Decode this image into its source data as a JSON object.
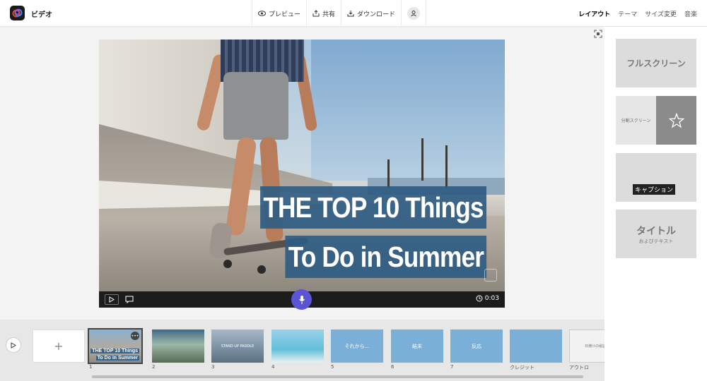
{
  "app": {
    "title": "ビデオ",
    "logo_icon": "adobe-express-logo"
  },
  "toolbar": {
    "preview_label": "プレビュー",
    "share_label": "共有",
    "download_label": "ダウンロード"
  },
  "tabs": {
    "layout": "レイアウト",
    "theme": "テーマ",
    "resize": "サイズ変更",
    "music": "音楽"
  },
  "video": {
    "caption_line1": "THE TOP 10 Things",
    "caption_line2": "To Do in Summer",
    "time": "0:03",
    "caption_color": "#2f5c82",
    "mic_color": "#5b55d6"
  },
  "layouts": {
    "fullscreen": "フルスクリーン",
    "split": "分割スクリーン",
    "caption": "キャプション",
    "title_main": "タイトル",
    "title_sub": "およびテキスト"
  },
  "timeline": {
    "add_label": "+",
    "slides": [
      {
        "num": "1",
        "text_line1": "THE TOP 10 Things",
        "text_line2": "To Do in Summer"
      },
      {
        "num": "2",
        "text": ""
      },
      {
        "num": "3",
        "text": "STAND UP PADDLE"
      },
      {
        "num": "4",
        "text": ""
      },
      {
        "num": "5",
        "text": "それから..."
      },
      {
        "num": "6",
        "text": "結末"
      },
      {
        "num": "7",
        "text": "反応"
      },
      {
        "num": "クレジット",
        "text": ""
      },
      {
        "num": "アウトロ",
        "text": "日焼けの秘訣"
      }
    ]
  }
}
